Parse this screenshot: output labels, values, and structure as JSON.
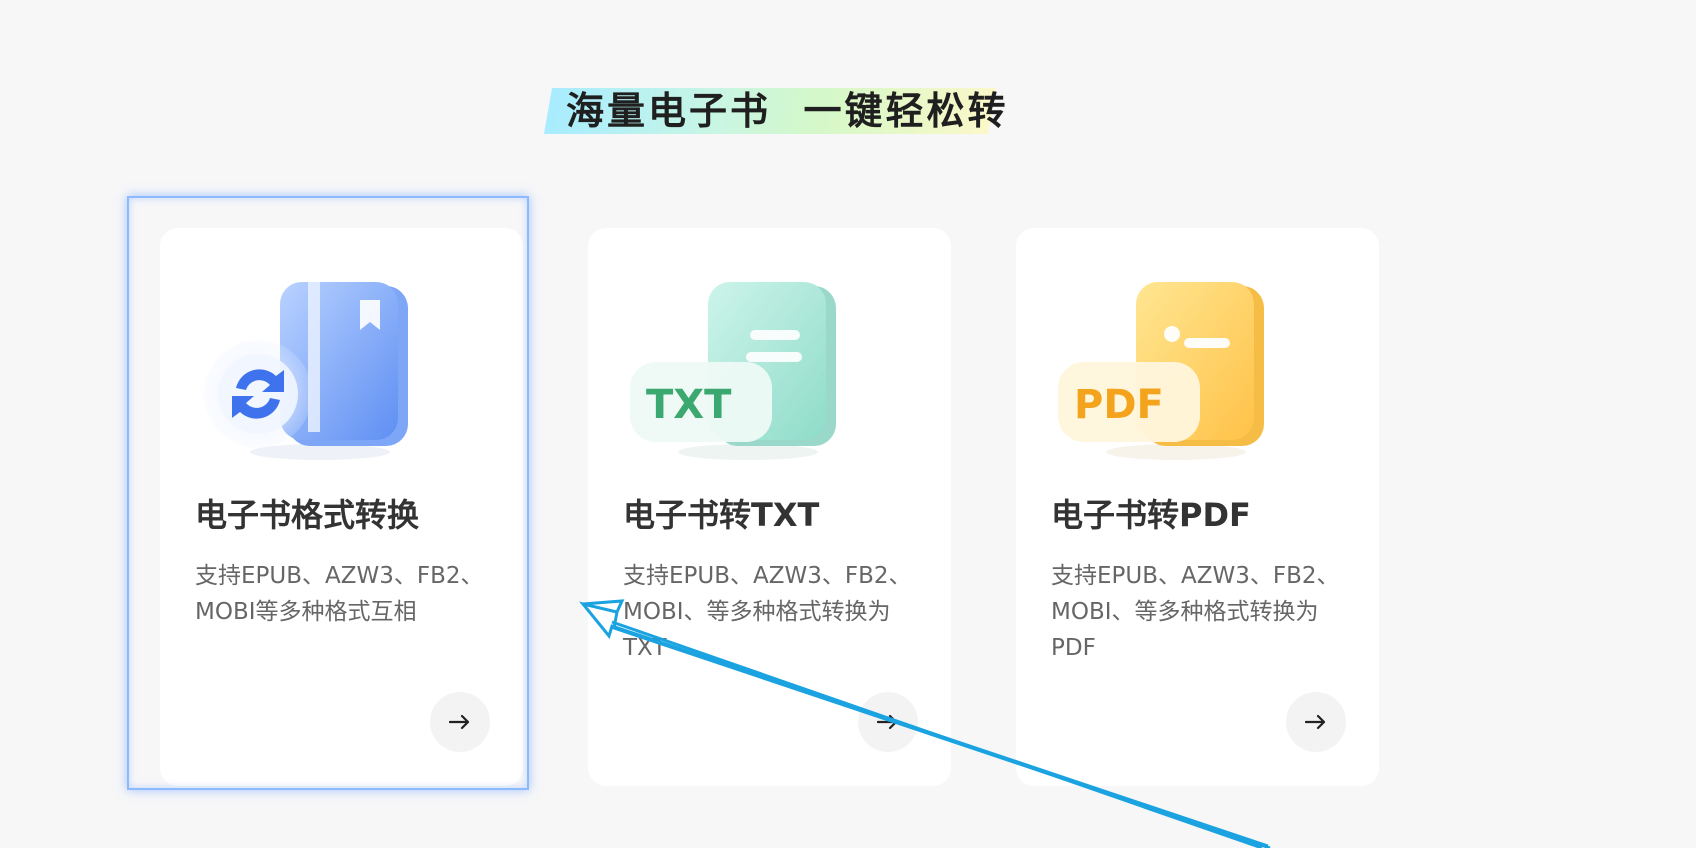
{
  "banner": {
    "title": "海量电子书  一键轻松转"
  },
  "cards": [
    {
      "title": "电子书格式转换",
      "description": "支持EPUB、AZW3、FB2、MOBI等多种格式互相",
      "icon": "book-convert-icon",
      "accent": "#6f9cf6",
      "selected": true
    },
    {
      "title": "电子书转TXT",
      "description": "支持EPUB、AZW3、FB2、MOBI、等多种格式转换为TXT",
      "icon": "txt-file-icon",
      "badge": "TXT",
      "accent": "#86dcc8"
    },
    {
      "title": "电子书转PDF",
      "description": "支持EPUB、AZW3、FB2、MOBI、等多种格式转换为PDF",
      "icon": "pdf-file-icon",
      "badge": "PDF",
      "accent": "#ffc84e"
    }
  ],
  "colors": {
    "background": "#f7f7f8",
    "card": "#ffffff",
    "annotation_arrow": "#1aa3e0",
    "selection_border": "#8db9ff"
  }
}
